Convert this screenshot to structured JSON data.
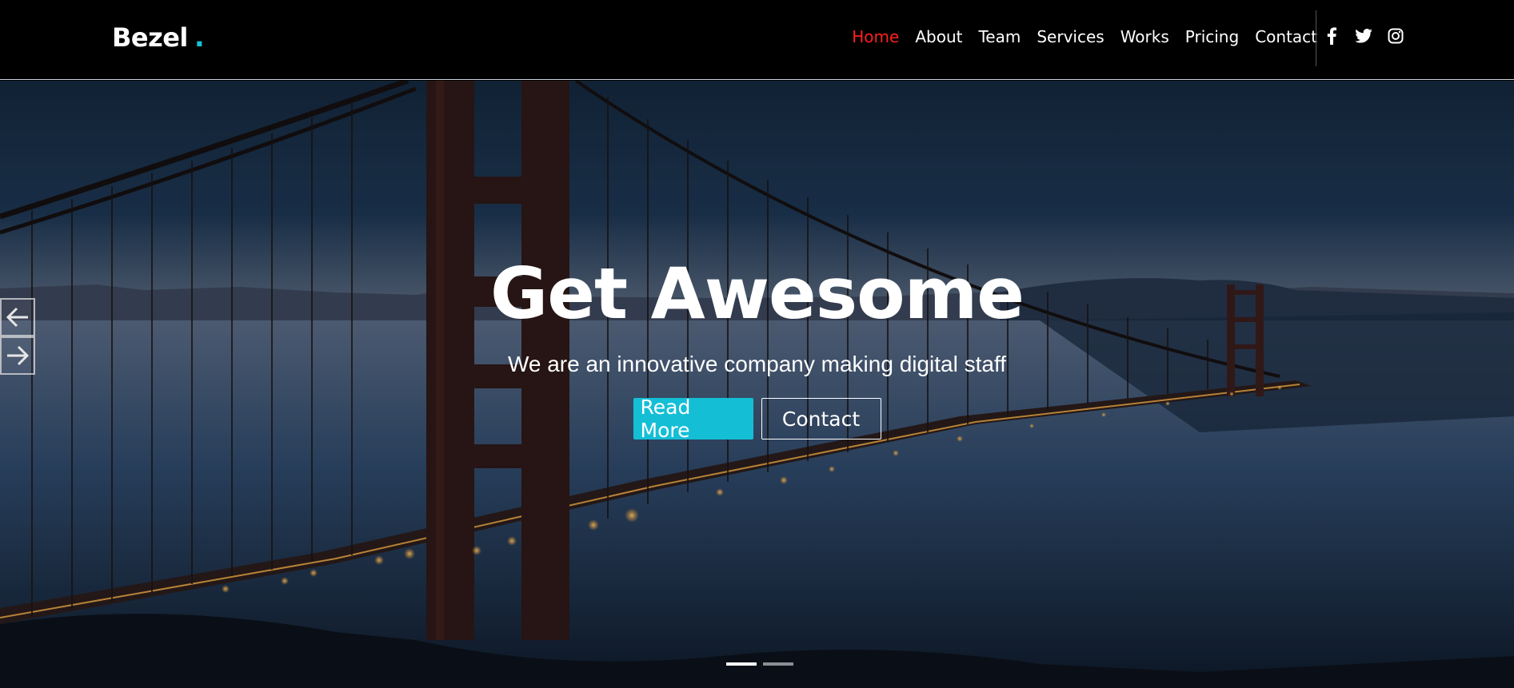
{
  "brand": {
    "name": "Bezel",
    "dot": ".",
    "accent": "#14c4d6"
  },
  "nav": {
    "items": [
      {
        "label": "Home",
        "active": true
      },
      {
        "label": "About"
      },
      {
        "label": "Team"
      },
      {
        "label": "Services"
      },
      {
        "label": "Works"
      },
      {
        "label": "Pricing"
      },
      {
        "label": "Contact"
      }
    ],
    "active_color": "#ff1f1f"
  },
  "socials": [
    "facebook-icon",
    "twitter-icon",
    "instagram-icon"
  ],
  "hero": {
    "title": "Get Awesome",
    "subtitle": "We are an innovative company making digital staff",
    "primary_button": "Read More",
    "secondary_button": "Contact",
    "primary_color": "#14bfd6",
    "slides": 2,
    "active_slide": 1
  }
}
